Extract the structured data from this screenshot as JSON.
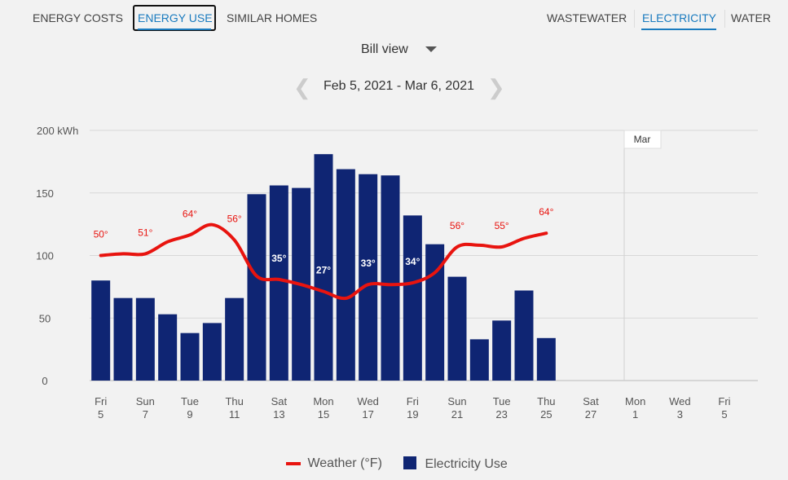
{
  "tabs_left": [
    {
      "label": "ENERGY COSTS",
      "active": false
    },
    {
      "label": "ENERGY USE",
      "active": true
    },
    {
      "label": "SIMILAR HOMES",
      "active": false
    }
  ],
  "tabs_right": [
    {
      "label": "WASTEWATER",
      "active": false
    },
    {
      "label": "ELECTRICITY",
      "active": true
    },
    {
      "label": "WATER",
      "active": false
    }
  ],
  "view_select": "Bill view",
  "date_range": "Feb 5, 2021 - Mar 6, 2021",
  "colors": {
    "bars": "#0f2573",
    "weather": "#e8140f",
    "accent": "#1a7bbf"
  },
  "chart_data": {
    "type": "bar",
    "ylabel": "",
    "ylim": [
      0,
      200
    ],
    "yticks": [
      "0",
      "50",
      "100",
      "150",
      "200 kWh"
    ],
    "ytick_values": [
      0,
      50,
      100,
      150,
      200
    ],
    "days": 30,
    "xticks": [
      {
        "d": "Fri",
        "n": "5"
      },
      {
        "d": "Sun",
        "n": "7"
      },
      {
        "d": "Tue",
        "n": "9"
      },
      {
        "d": "Thu",
        "n": "11"
      },
      {
        "d": "Sat",
        "n": "13"
      },
      {
        "d": "Mon",
        "n": "15"
      },
      {
        "d": "Wed",
        "n": "17"
      },
      {
        "d": "Fri",
        "n": "19"
      },
      {
        "d": "Sun",
        "n": "21"
      },
      {
        "d": "Tue",
        "n": "23"
      },
      {
        "d": "Thu",
        "n": "25"
      },
      {
        "d": "Sat",
        "n": "27"
      },
      {
        "d": "Mon",
        "n": "1"
      },
      {
        "d": "Wed",
        "n": "3"
      },
      {
        "d": "Fri",
        "n": "5"
      }
    ],
    "month_marker": {
      "label": "Mar",
      "day_index": 24
    },
    "series": [
      {
        "name": "Electricity Use",
        "type": "bar",
        "values": [
          80,
          66,
          66,
          53,
          38,
          46,
          66,
          149,
          156,
          154,
          181,
          169,
          165,
          164,
          132,
          109,
          83,
          33,
          48,
          72,
          34
        ]
      },
      {
        "name": "Weather (°F)",
        "type": "line",
        "values": [
          50,
          51,
          51,
          58,
          62,
          68,
          59,
          38,
          36,
          33,
          29,
          25,
          33,
          33,
          34,
          40,
          55,
          56,
          55,
          60,
          63
        ]
      }
    ],
    "temp_labels": [
      {
        "i": 0,
        "t": "50°"
      },
      {
        "i": 2,
        "t": "51°"
      },
      {
        "i": 4,
        "t": "64°"
      },
      {
        "i": 6,
        "t": "56°"
      },
      {
        "i": 8,
        "t": "35°"
      },
      {
        "i": 10,
        "t": "27°"
      },
      {
        "i": 12,
        "t": "33°"
      },
      {
        "i": 14,
        "t": "34°"
      },
      {
        "i": 16,
        "t": "56°"
      },
      {
        "i": 18,
        "t": "55°"
      },
      {
        "i": 20,
        "t": "64°"
      }
    ],
    "legend": {
      "weather": "Weather (°F)",
      "use": "Electricity Use",
      "placement": "bottom"
    }
  }
}
